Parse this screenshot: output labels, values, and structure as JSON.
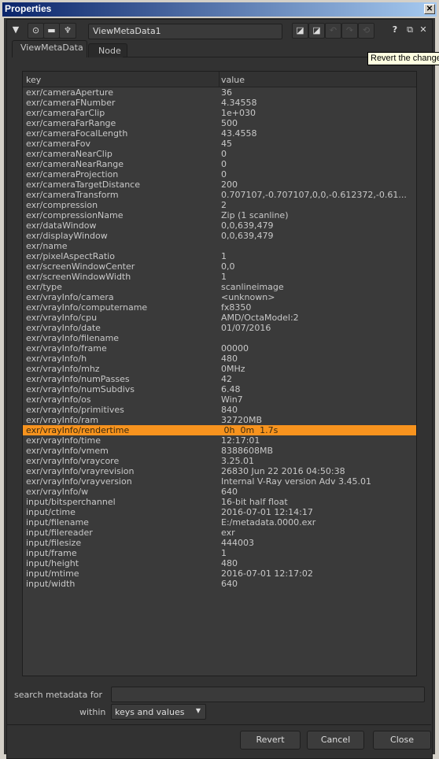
{
  "window": {
    "title": "Properties",
    "close_icon": "x"
  },
  "toolbar": {
    "node_name": "ViewMetaData1",
    "icons": [
      "collapse-triangle-icon",
      "viewer-circle-icon",
      "tv-icon",
      "wrench-icon",
      "color-swatch-icon",
      "color-swatch-icon",
      "undo-icon",
      "redo-icon",
      "revert-icon",
      "help-icon",
      "float-icon",
      "close-icon"
    ]
  },
  "tabs": [
    {
      "label": "ViewMetaData",
      "active": true
    },
    {
      "label": "Node",
      "active": false
    }
  ],
  "tooltip": "Revert the changes",
  "table": {
    "columns": [
      "key",
      "value"
    ],
    "selected_key": "exr/vrayInfo/rendertime",
    "rows": [
      [
        "exr/cameraAperture",
        "36"
      ],
      [
        "exr/cameraFNumber",
        "4.34558"
      ],
      [
        "exr/cameraFarClip",
        "1e+030"
      ],
      [
        "exr/cameraFarRange",
        "500"
      ],
      [
        "exr/cameraFocalLength",
        "43.4558"
      ],
      [
        "exr/cameraFov",
        "45"
      ],
      [
        "exr/cameraNearClip",
        "0"
      ],
      [
        "exr/cameraNearRange",
        "0"
      ],
      [
        "exr/cameraProjection",
        "0"
      ],
      [
        "exr/cameraTargetDistance",
        "200"
      ],
      [
        "exr/cameraTransform",
        "0.707107,-0.707107,0,0,-0.612372,-0.61..."
      ],
      [
        "exr/compression",
        "2"
      ],
      [
        "exr/compressionName",
        "Zip (1 scanline)"
      ],
      [
        "exr/dataWindow",
        "0,0,639,479"
      ],
      [
        "exr/displayWindow",
        "0,0,639,479"
      ],
      [
        "exr/name",
        ""
      ],
      [
        "exr/pixelAspectRatio",
        "1"
      ],
      [
        "exr/screenWindowCenter",
        "0,0"
      ],
      [
        "exr/screenWindowWidth",
        "1"
      ],
      [
        "exr/type",
        "scanlineimage"
      ],
      [
        "exr/vrayInfo/camera",
        "<unknown>"
      ],
      [
        "exr/vrayInfo/computername",
        "fx8350"
      ],
      [
        "exr/vrayInfo/cpu",
        "AMD/OctaModel:2"
      ],
      [
        "exr/vrayInfo/date",
        "01/07/2016"
      ],
      [
        "exr/vrayInfo/filename",
        ""
      ],
      [
        "exr/vrayInfo/frame",
        "00000"
      ],
      [
        "exr/vrayInfo/h",
        "480"
      ],
      [
        "exr/vrayInfo/mhz",
        "0MHz"
      ],
      [
        "exr/vrayInfo/numPasses",
        "42"
      ],
      [
        "exr/vrayInfo/numSubdivs",
        "6.48"
      ],
      [
        "exr/vrayInfo/os",
        "Win7"
      ],
      [
        "exr/vrayInfo/primitives",
        "840"
      ],
      [
        "exr/vrayInfo/ram",
        "32720MB"
      ],
      [
        "exr/vrayInfo/rendertime",
        " 0h  0m  1.7s"
      ],
      [
        "exr/vrayInfo/time",
        "12:17:01"
      ],
      [
        "exr/vrayInfo/vmem",
        "8388608MB"
      ],
      [
        "exr/vrayInfo/vraycore",
        "3.25.01"
      ],
      [
        "exr/vrayInfo/vrayrevision",
        "26830 Jun 22 2016 04:50:38"
      ],
      [
        "exr/vrayInfo/vrayversion",
        "Internal V-Ray version Adv 3.45.01"
      ],
      [
        "exr/vrayInfo/w",
        "640"
      ],
      [
        "input/bitsperchannel",
        "16-bit half float"
      ],
      [
        "input/ctime",
        "2016-07-01 12:14:17"
      ],
      [
        "input/filename",
        "E:/metadata.0000.exr"
      ],
      [
        "input/filereader",
        "exr"
      ],
      [
        "input/filesize",
        "444003"
      ],
      [
        "input/frame",
        "1"
      ],
      [
        "input/height",
        "480"
      ],
      [
        "input/mtime",
        "2016-07-01 12:17:02"
      ],
      [
        "input/width",
        "640"
      ]
    ]
  },
  "search": {
    "label": "search metadata for",
    "value": "",
    "within_label": "within",
    "within_value": "keys and values"
  },
  "buttons": {
    "revert": "Revert",
    "cancel": "Cancel",
    "close": "Close"
  },
  "colors": {
    "selection": "#f7931e",
    "titlebar_start": "#0a246a",
    "titlebar_end": "#a6caf0",
    "panel": "#323232"
  }
}
